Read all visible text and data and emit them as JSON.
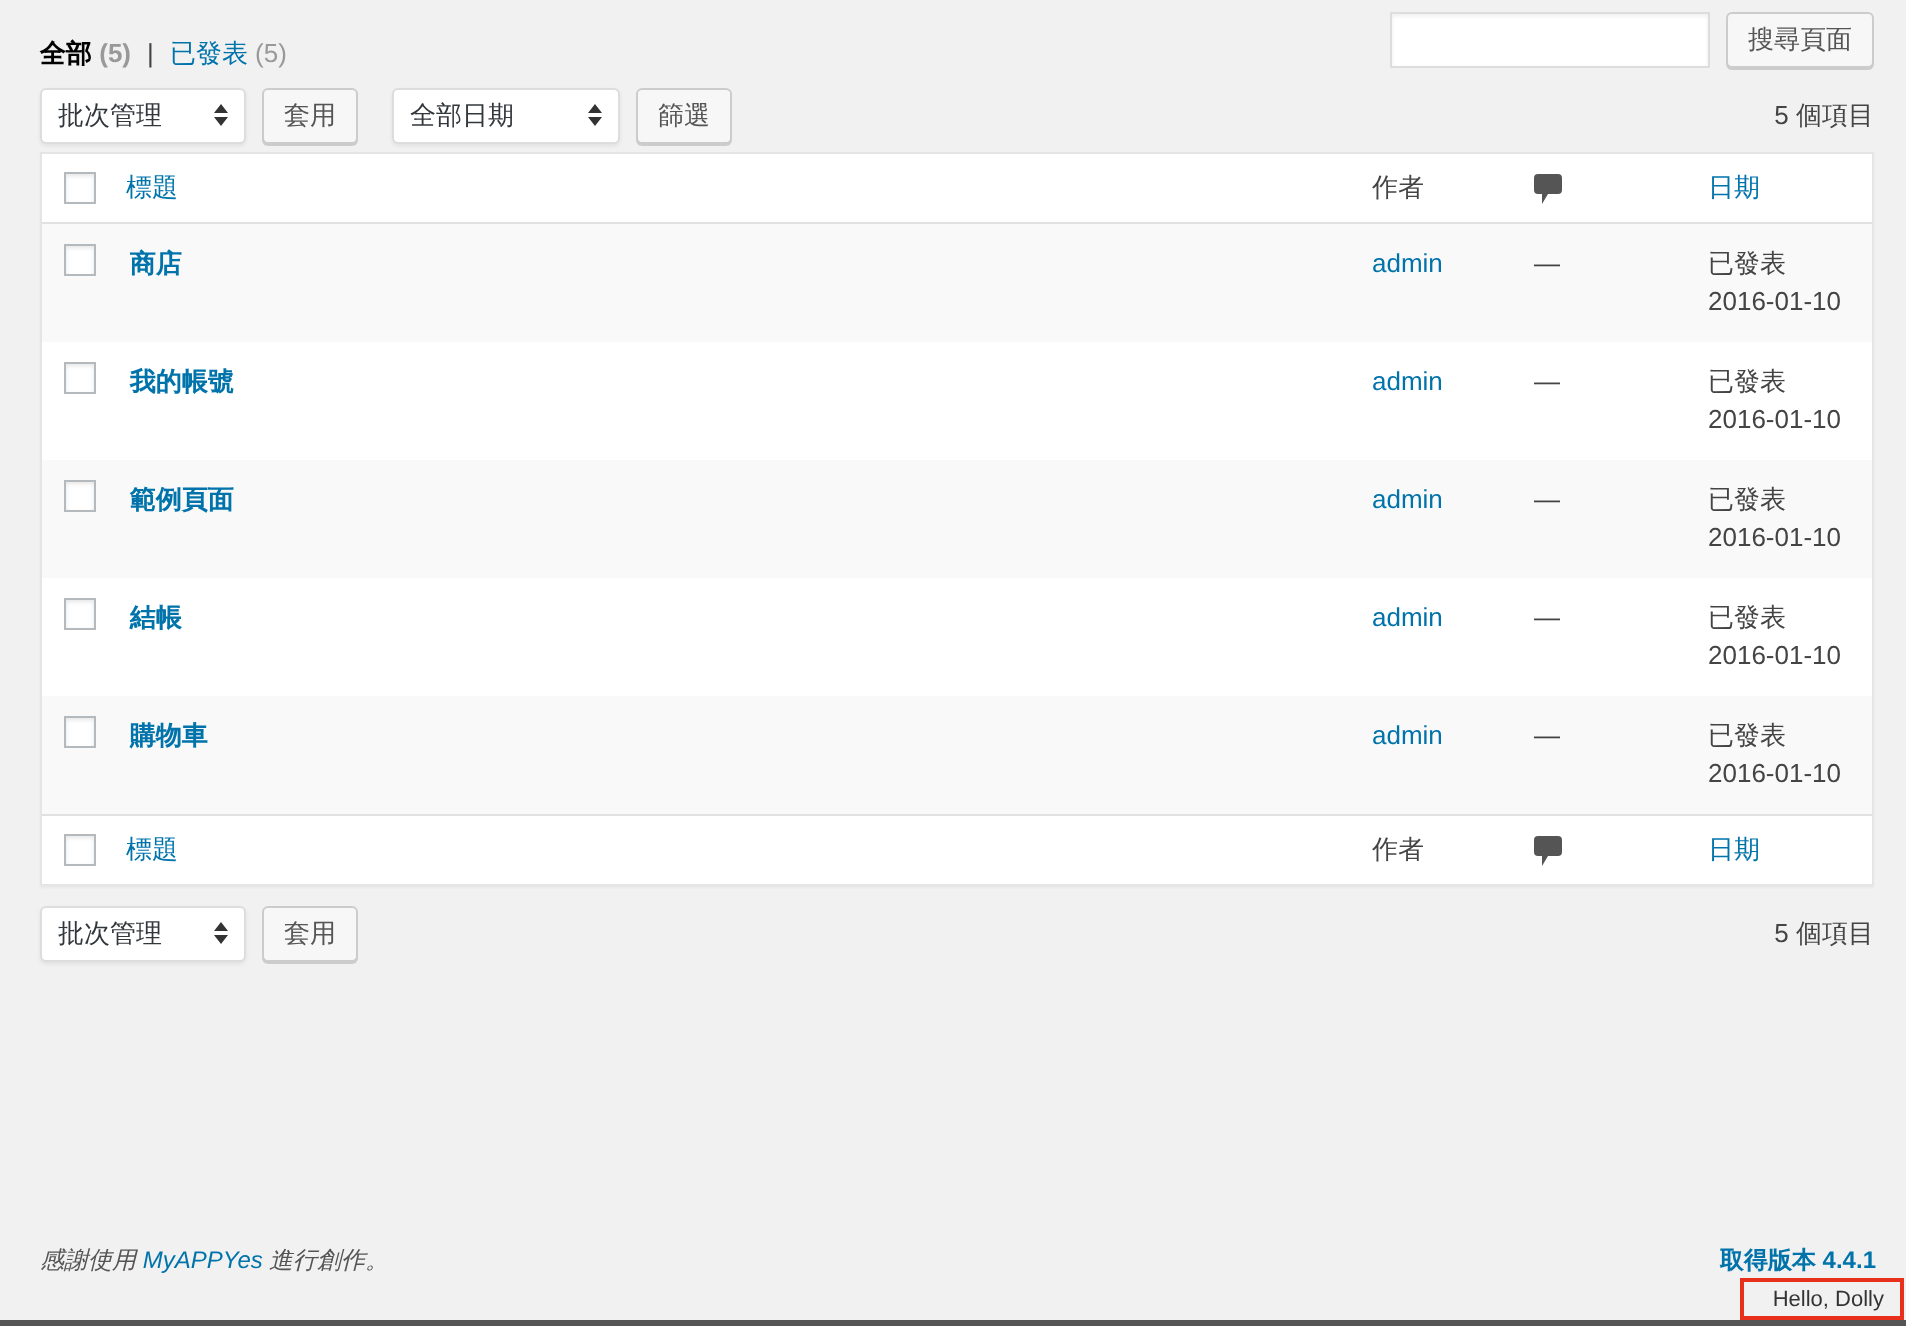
{
  "filters": [
    {
      "label": "全部",
      "count": "(5)",
      "selected": true
    },
    {
      "label": "已發表",
      "count": "(5)",
      "selected": false
    }
  ],
  "filter_separator": "|",
  "search": {
    "button": "搜尋頁面"
  },
  "top_actions": {
    "bulk_select": "批次管理",
    "apply": "套用",
    "date_select": "全部日期",
    "filter": "篩選",
    "item_count": "5 個項目"
  },
  "table": {
    "select_all_top": {
      "checked": false
    },
    "select_all_bottom": {
      "checked": false
    },
    "columns": [
      {
        "label": "標題",
        "kind": "link"
      },
      {
        "label": "作者",
        "kind": "text"
      },
      {
        "kind": "comment-icon"
      },
      {
        "label": "日期",
        "kind": "link"
      }
    ],
    "footer_columns": [
      {
        "label": "標題",
        "kind": "link"
      },
      {
        "label": "作者",
        "kind": "text"
      },
      {
        "kind": "comment-icon"
      },
      {
        "label": "日期",
        "kind": "link"
      }
    ],
    "rows": [
      {
        "title": "商店",
        "author": "admin",
        "comments": "—",
        "status": "已發表",
        "date": "2016-01-10",
        "checked": false
      },
      {
        "title": "我的帳號",
        "author": "admin",
        "comments": "—",
        "status": "已發表",
        "date": "2016-01-10",
        "checked": false
      },
      {
        "title": "範例頁面",
        "author": "admin",
        "comments": "—",
        "status": "已發表",
        "date": "2016-01-10",
        "checked": false
      },
      {
        "title": "結帳",
        "author": "admin",
        "comments": "—",
        "status": "已發表",
        "date": "2016-01-10",
        "checked": false
      },
      {
        "title": "購物車",
        "author": "admin",
        "comments": "—",
        "status": "已發表",
        "date": "2016-01-10",
        "checked": false
      }
    ]
  },
  "bottom_actions": {
    "bulk_select": "批次管理",
    "apply": "套用",
    "item_count": "5 個項目"
  },
  "footer": {
    "thanks_before": "感謝使用",
    "link": "MyAPPYes",
    "thanks_after": "進行創作。",
    "version": "取得版本 4.4.1",
    "hello": "Hello, Dolly"
  }
}
